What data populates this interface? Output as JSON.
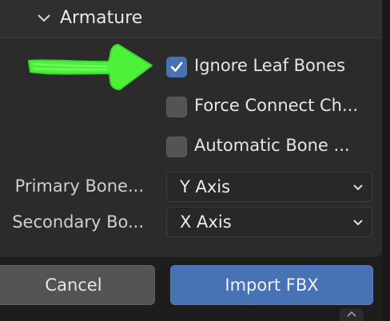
{
  "panel": {
    "title": "Armature",
    "checkboxes": [
      {
        "label": "Ignore Leaf Bones",
        "checked": true
      },
      {
        "label": "Force Connect Ch...",
        "checked": false
      },
      {
        "label": "Automatic Bone ...",
        "checked": false
      }
    ],
    "properties": [
      {
        "label": "Primary Bone...",
        "value": "Y Axis"
      },
      {
        "label": "Secondary Bo...",
        "value": "X Axis"
      }
    ]
  },
  "buttons": {
    "cancel": "Cancel",
    "import": "Import FBX"
  },
  "colors": {
    "accent": "#4772b3",
    "annotation_arrow": "#4cf23a",
    "panel_bg": "#2b2b2b"
  },
  "icons": {
    "section_toggle": "chevron-down-icon",
    "checkmark": "checkmark-icon",
    "dropdown": "chevron-down-icon",
    "annotation": "arrow-right-icon"
  }
}
